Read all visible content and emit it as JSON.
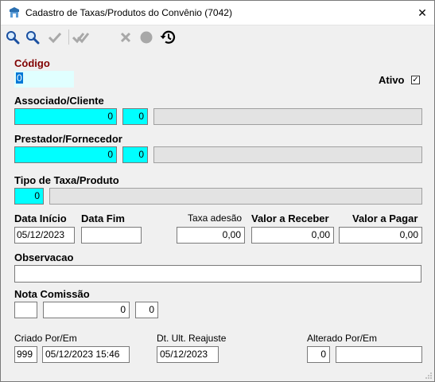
{
  "window": {
    "title": "Cadastro de Taxas/Produtos do Convênio (7042)",
    "close_symbol": "✕"
  },
  "form": {
    "codigo": {
      "label": "Código",
      "value": "0"
    },
    "ativo": {
      "label": "Ativo",
      "checked": true,
      "check_symbol": "✓"
    },
    "associado": {
      "label": "Associado/Cliente",
      "value1": "0",
      "value2": "0",
      "name": ""
    },
    "prestador": {
      "label": "Prestador/Fornecedor",
      "value1": "0",
      "value2": "0",
      "name": ""
    },
    "tipo": {
      "label": "Tipo de Taxa/Produto",
      "value": "0",
      "name": ""
    },
    "data_inicio": {
      "label": "Data Início",
      "value": "05/12/2023"
    },
    "data_fim": {
      "label": "Data Fim",
      "value": ""
    },
    "taxa_adesao": {
      "label": "Taxa adesão",
      "value": "0,00"
    },
    "valor_receber": {
      "label": "Valor a Receber",
      "value": "0,00"
    },
    "valor_pagar": {
      "label": "Valor a Pagar",
      "value": "0,00"
    },
    "observacao": {
      "label": "Observacao",
      "value": ""
    },
    "nota_comissao": {
      "label": "Nota Comissão",
      "value1": "",
      "value2": "0",
      "value3": "0"
    },
    "criado": {
      "label": "Criado Por/Em",
      "user": "999",
      "datetime": "05/12/2023 15:46"
    },
    "reajuste": {
      "label": "Dt. Ult. Reajuste",
      "value": "05/12/2023"
    },
    "alterado": {
      "label": "Alterado Por/Em",
      "user": "0",
      "datetime": ""
    }
  },
  "colors": {
    "required": "#00ffff",
    "readonly": "#e3e3e3",
    "accent_label": "#800000"
  }
}
